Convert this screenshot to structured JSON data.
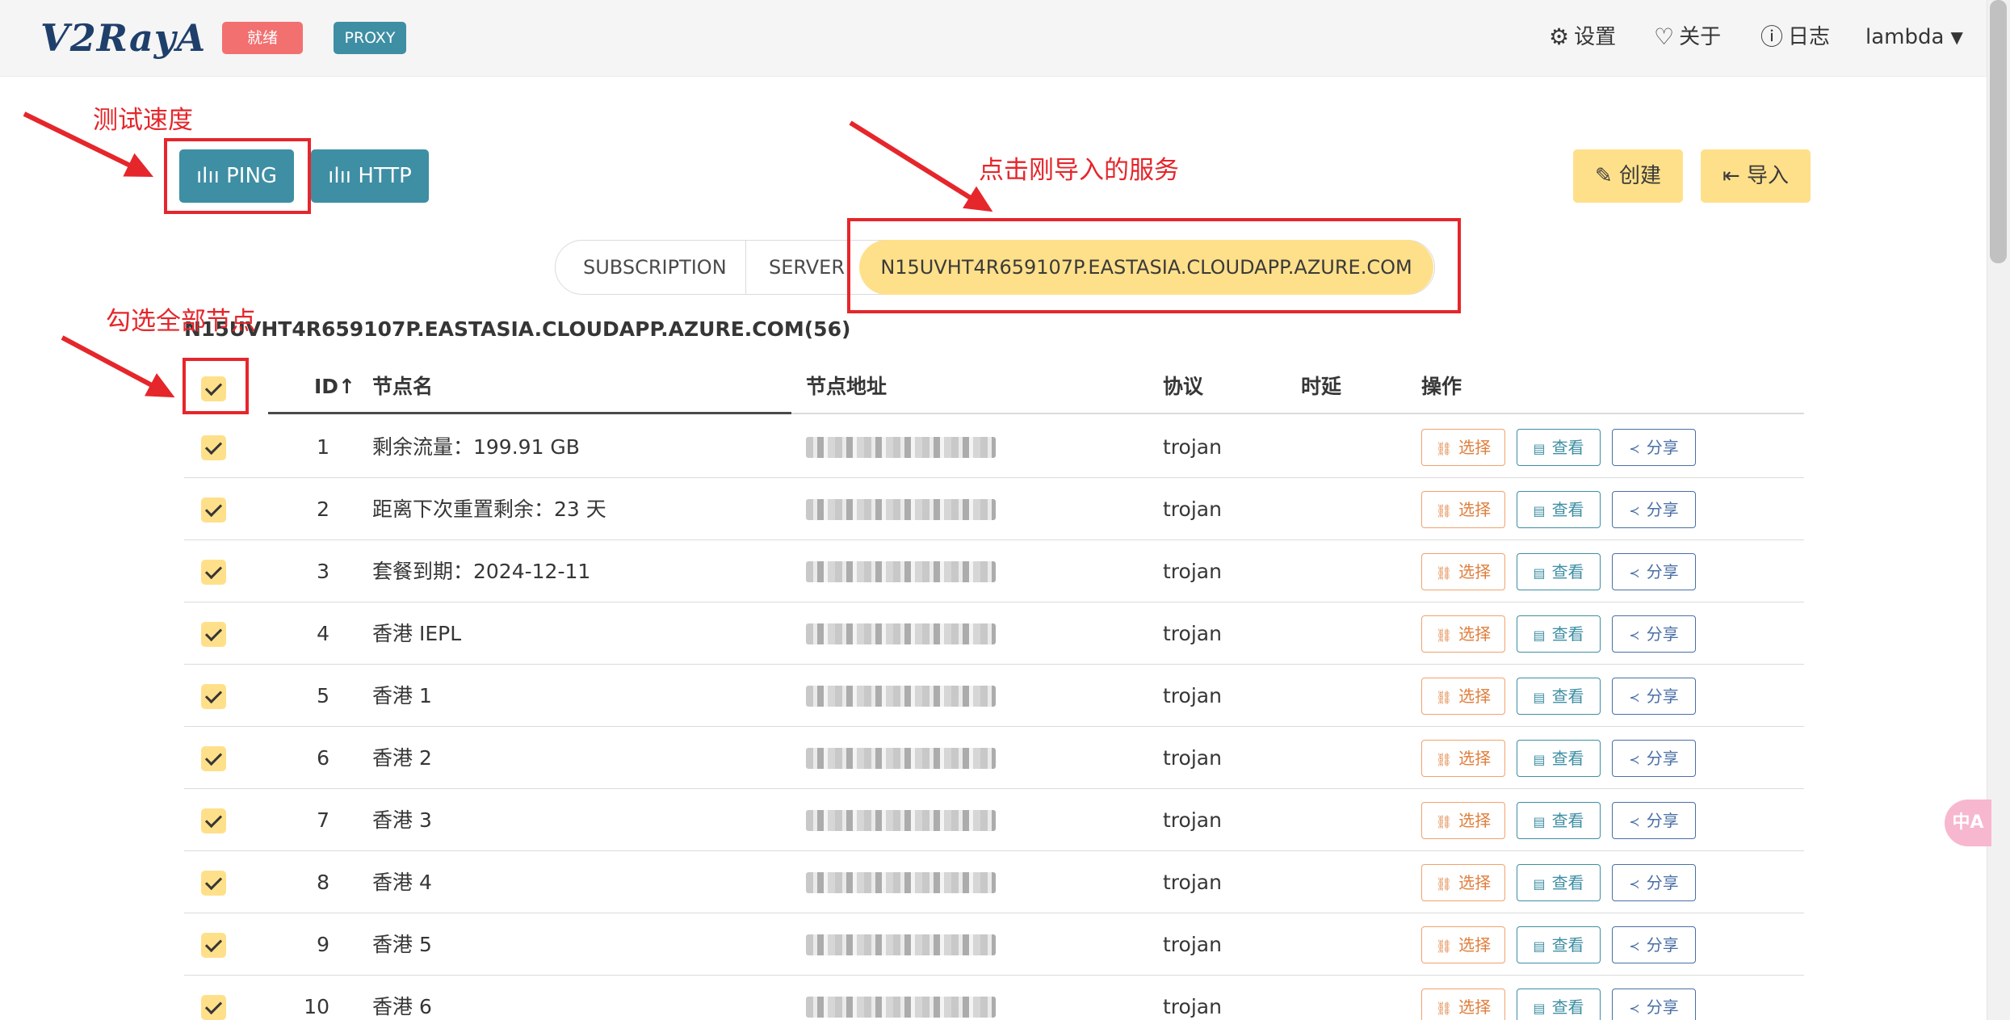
{
  "header": {
    "logo": "V2RayA",
    "status_tag": "就绪",
    "mode_tag": "PROXY",
    "nav": [
      {
        "icon": "gear-icon",
        "label": "设置"
      },
      {
        "icon": "heart-icon",
        "label": "关于"
      },
      {
        "icon": "info-icon",
        "label": "日志"
      }
    ],
    "user": "lambda"
  },
  "toolbar": {
    "ping_label": "PING",
    "http_label": "HTTP",
    "create_label": "创建",
    "import_label": "导入"
  },
  "tabs": {
    "subscription": "SUBSCRIPTION",
    "server": "SERVER",
    "active": "N15UVHT4R659107P.EASTASIA.CLOUDAPP.AZURE.COM"
  },
  "group_title": "N15UVHT4R659107P.EASTASIA.CLOUDAPP.AZURE.COM(56)",
  "table": {
    "headers": {
      "id": "ID↑",
      "name": "节点名",
      "address": "节点地址",
      "protocol": "协议",
      "latency": "时延",
      "actions": "操作"
    },
    "action_labels": {
      "select": "选择",
      "view": "查看",
      "share": "分享"
    },
    "rows": [
      {
        "id": "1",
        "name": "剩余流量：199.91 GB",
        "protocol": "trojan"
      },
      {
        "id": "2",
        "name": "距离下次重置剩余：23 天",
        "protocol": "trojan"
      },
      {
        "id": "3",
        "name": "套餐到期：2024-12-11",
        "protocol": "trojan"
      },
      {
        "id": "4",
        "name": "香港 IEPL",
        "protocol": "trojan"
      },
      {
        "id": "5",
        "name": "香港 1",
        "protocol": "trojan"
      },
      {
        "id": "6",
        "name": "香港 2",
        "protocol": "trojan"
      },
      {
        "id": "7",
        "name": "香港 3",
        "protocol": "trojan"
      },
      {
        "id": "8",
        "name": "香港 4",
        "protocol": "trojan"
      },
      {
        "id": "9",
        "name": "香港 5",
        "protocol": "trojan"
      },
      {
        "id": "10",
        "name": "香港 6",
        "protocol": "trojan"
      }
    ]
  },
  "annotations": {
    "speed_test": "测试速度",
    "click_imported": "点击刚导入的服务",
    "select_all": "勾选全部节点"
  },
  "colors": {
    "accent": "#3e8ea4",
    "warning": "#ffe08a",
    "danger": "#f27070",
    "annotation": "#e5262b"
  }
}
